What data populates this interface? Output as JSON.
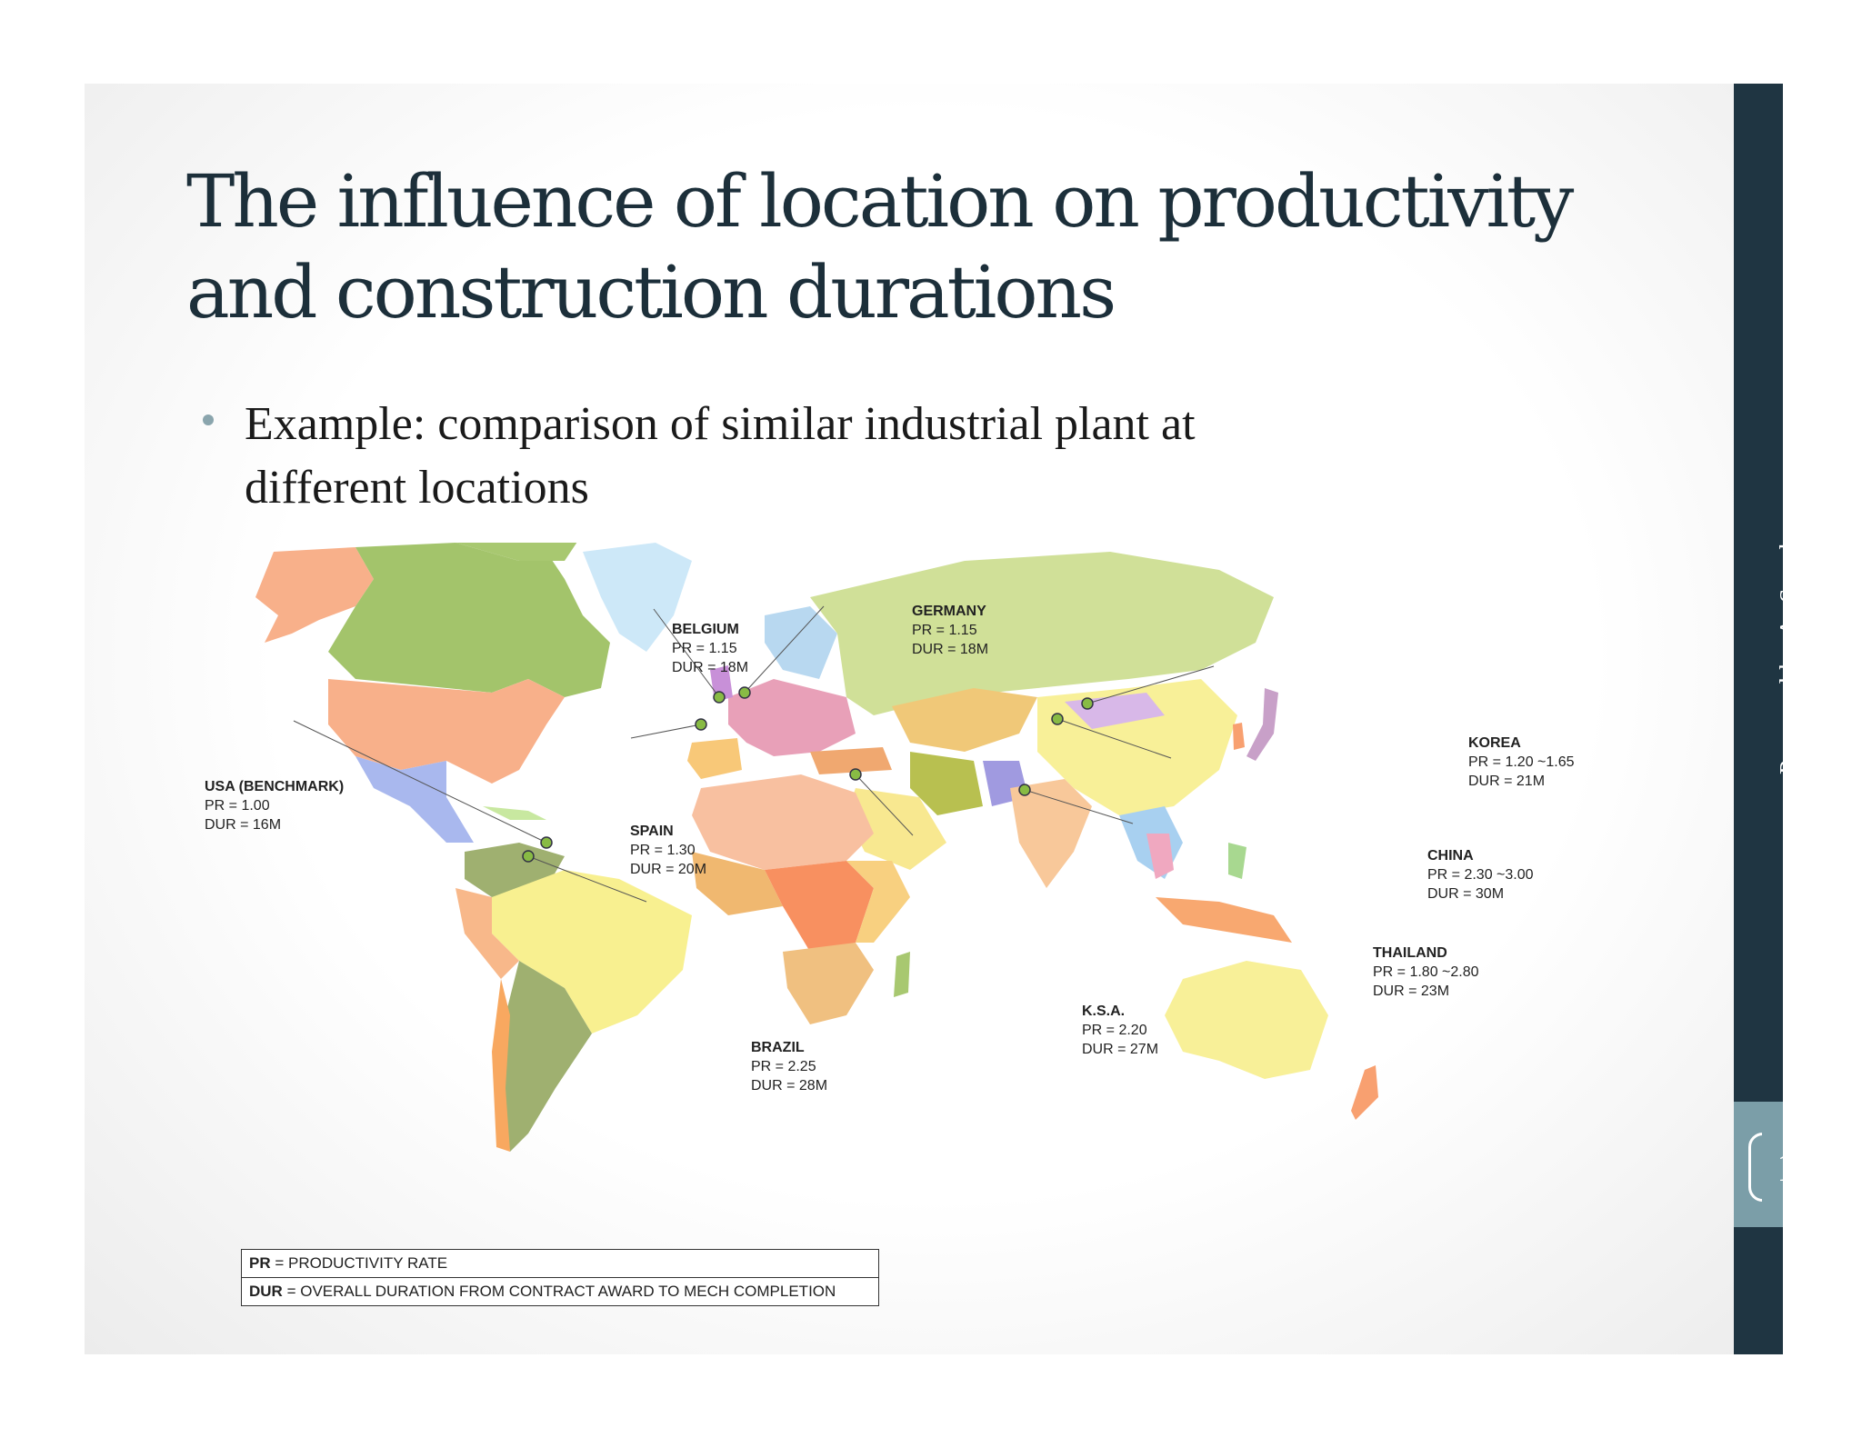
{
  "slide": {
    "title_line1": "The influence of location on productivity",
    "title_line2": "and construction durations",
    "bullet_line1": "Example: comparison of similar industrial plant at",
    "bullet_line2": "different locations",
    "author": "Prepared by A. Sanchez",
    "page_number": "17"
  },
  "map": {
    "locations": [
      {
        "name": "USA (BENCHMARK)",
        "pr": "PR = 1.00",
        "dur": "DUR = 16M"
      },
      {
        "name": "BELGIUM",
        "pr": "PR = 1.15",
        "dur": "DUR = 18M"
      },
      {
        "name": "GERMANY",
        "pr": "PR = 1.15",
        "dur": "DUR = 18M"
      },
      {
        "name": "SPAIN",
        "pr": "PR = 1.30",
        "dur": "DUR = 20M"
      },
      {
        "name": "BRAZIL",
        "pr": "PR = 2.25",
        "dur": "DUR = 28M"
      },
      {
        "name": "K.S.A.",
        "pr": "PR = 2.20",
        "dur": "DUR = 27M"
      },
      {
        "name": "THAILAND",
        "pr": "PR = 1.80 ~2.80",
        "dur": "DUR = 23M"
      },
      {
        "name": "CHINA",
        "pr": "PR = 2.30 ~3.00",
        "dur": "DUR = 30M"
      },
      {
        "name": "KOREA",
        "pr": "PR = 1.20 ~1.65",
        "dur": "DUR = 21M"
      }
    ]
  },
  "legend": {
    "pr_abbr": "PR",
    "pr_text": " = PRODUCTIVITY RATE",
    "dur_abbr": "DUR",
    "dur_text": " = OVERALL DURATION FROM CONTRACT AWARD TO MECH COMPLETION"
  },
  "colors": {
    "title": "#1c2f3a",
    "sidebar": "#1f3542",
    "page_box": "#7b9ea8"
  }
}
